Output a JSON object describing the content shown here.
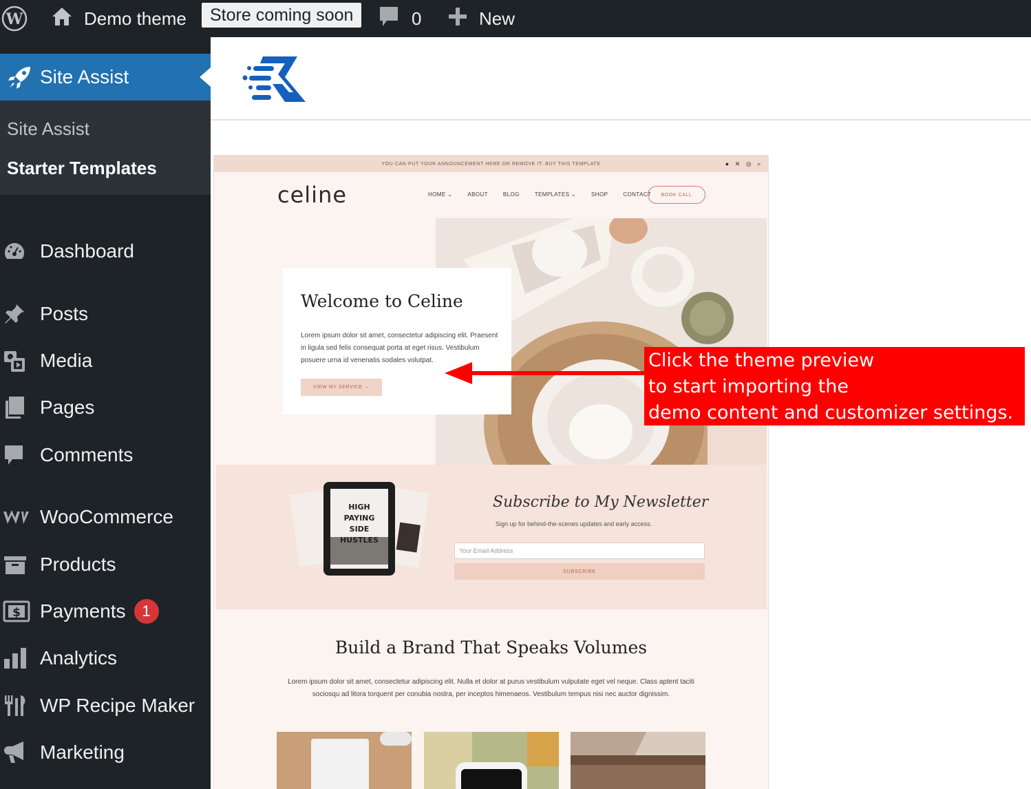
{
  "admin_bar": {
    "site_name": "Demo theme",
    "store_status": "Store coming soon",
    "comment_count": "0",
    "new_label": "New"
  },
  "sidebar": {
    "active_menu": "Site Assist",
    "submenu": [
      "Site Assist",
      "Starter Templates"
    ],
    "items": [
      {
        "label": "Dashboard",
        "icon": "dashboard-icon"
      },
      {
        "label": "Posts",
        "icon": "pin-icon"
      },
      {
        "label": "Media",
        "icon": "media-icon"
      },
      {
        "label": "Pages",
        "icon": "pages-icon"
      },
      {
        "label": "Comments",
        "icon": "comment-icon"
      },
      {
        "label": "WooCommerce",
        "icon": "woocommerce-icon"
      },
      {
        "label": "Products",
        "icon": "archive-box-icon"
      },
      {
        "label": "Payments",
        "icon": "dollar-icon",
        "badge": "1"
      },
      {
        "label": "Analytics",
        "icon": "bar-chart-icon"
      },
      {
        "label": "WP Recipe Maker",
        "icon": "utensils-icon"
      },
      {
        "label": "Marketing",
        "icon": "megaphone-icon"
      }
    ]
  },
  "preview": {
    "announcement": "YOU CAN PUT YOUR ANNOUNCEMENT HERE OR REMOVE IT. BUY THIS TEMPLATE",
    "site_logo": "celine",
    "nav": [
      "HOME ⌄",
      "ABOUT",
      "BLOG",
      "TEMPLATES ⌄",
      "SHOP",
      "CONTACT"
    ],
    "book_call": "BOOK CALL",
    "hero_title": "Welcome to Celine",
    "hero_text": "Lorem ipsum dolor sit amet, consectetur adipiscing elit. Praesent in ligula sed felis consequat porta at eget risus. Vestibulum posuere urna id venenatis sodales volutpat.",
    "hero_button": "VIEW MY SERVICE →",
    "newsletter_title": "Subscribe to My Newsletter",
    "newsletter_sub": "Sign up for behind-the-scenes updates and early access.",
    "email_placeholder": "Your Email Address",
    "subscribe": "SUBSCRIBE",
    "mockup_lines": [
      "HIGH",
      "PAYING",
      "SIDE",
      "HUSTLES"
    ],
    "brand_title": "Build a Brand That Speaks Volumes",
    "brand_text": "Lorem ipsum dolor sit amet, consectetur adipiscing elit. Nulla et dolor at purus vestibulum vulputate eget vel neque. Class aptent taciti sociosqu ad litora torquent per conubia nostra, per inceptos himenaeos. Vestibulum tempus nisi nec auctor dignissim."
  },
  "callout": {
    "lines": [
      "Click the theme preview",
      "to start importing the",
      "demo content and customizer settings."
    ]
  },
  "colors": {
    "admin_bg": "#1d2327",
    "active_blue": "#2271b1",
    "callout_red": "#ff0000",
    "brand_blue": "#1560bd"
  }
}
